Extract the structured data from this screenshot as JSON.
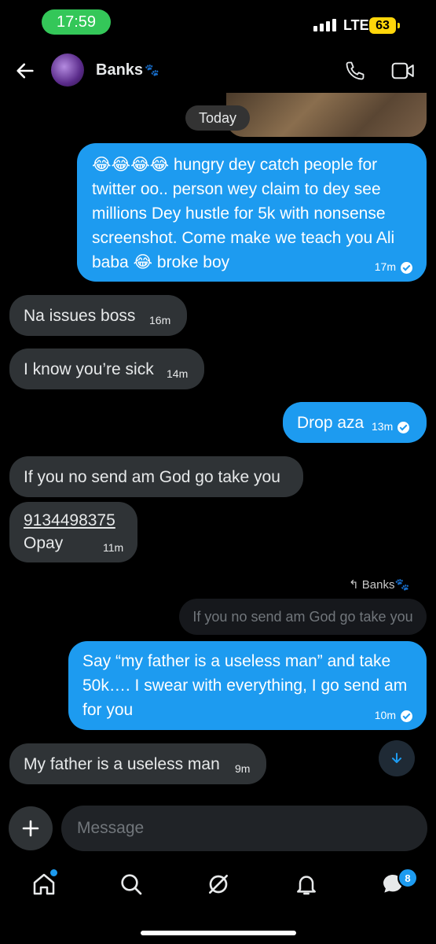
{
  "status_bar": {
    "time": "17:59",
    "network": "LTE",
    "battery": "63"
  },
  "header": {
    "contact_name": "Banks",
    "contact_emoji": "🐾"
  },
  "date_divider": "Today",
  "messages": [
    {
      "dir": "out",
      "text": "😂😂😂😂 hungry dey catch people for twitter oo.. person wey claim to dey see millions Dey hustle for 5k with nonsense screenshot. Come make we teach you Ali baba 😂 broke boy",
      "time": "17m"
    },
    {
      "dir": "in",
      "text": "Na issues  boss",
      "time": "16m"
    },
    {
      "dir": "in",
      "text": "I know you’re sick",
      "time": "14m"
    },
    {
      "dir": "out",
      "text": "Drop aza",
      "time": "13m"
    },
    {
      "dir": "in",
      "text": "If you no send am God go take you",
      "time": ""
    },
    {
      "dir": "in",
      "line1": "9134498375",
      "line2": "Opay",
      "time": "11m"
    },
    {
      "dir": "out",
      "text": "Say  “my father is a useless man” and take 50k…. I swear with everything, I go send am for you",
      "time": "10m"
    },
    {
      "dir": "in",
      "text": "My father is a useless man",
      "time": "9m"
    }
  ],
  "reply_ref": {
    "label": "Banks",
    "label_emoji": "🐾",
    "quote": "If you no send am God go take you"
  },
  "composer": {
    "placeholder": "Message"
  },
  "tabbar": {
    "messages_badge": "8"
  },
  "colors": {
    "accent": "#1d9bf0",
    "incoming_bubble": "#2f3336",
    "background": "#000000"
  }
}
